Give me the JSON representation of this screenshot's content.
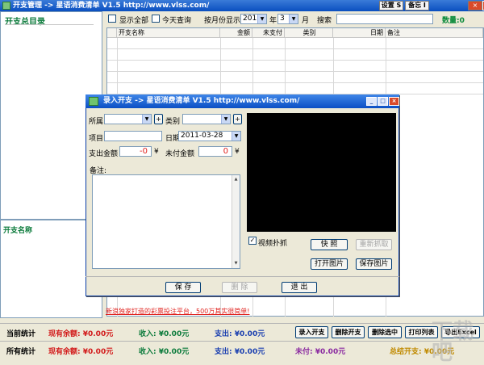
{
  "app": {
    "title": "开支管理 -> 星语消费清单 V1.5 http://www.vlss.com/",
    "settings_btn": "设置 S",
    "memo_btn": "备忘 I",
    "close_btn": "×"
  },
  "left": {
    "title": "开支总目录",
    "name_label": "开支名称"
  },
  "filter": {
    "show_all": "显示全部",
    "today_query": "今天查询",
    "by_month": "按月份显示",
    "year_value": "2011",
    "year_unit": "年",
    "month_value": "3",
    "month_unit": "月",
    "search_label": "搜索",
    "count_label": "数量:0"
  },
  "table": {
    "columns": [
      "",
      "开支名称",
      "金额",
      "未支付",
      "类别",
      "日期",
      "备注"
    ]
  },
  "dialog": {
    "title": "录入开支 -> 星语消费清单 V1.5 http://www.vlss.com/",
    "owner_label": "所属",
    "category_label": "类别",
    "item_label": "项目",
    "date_label": "日期",
    "date_value": "2011-03-28",
    "expense_label": "支出金额",
    "expense_value": "-0",
    "yen": "¥",
    "unpaid_label": "未付金额",
    "unpaid_value": "0",
    "memo_label": "备注:",
    "plus": "+",
    "video_capture": "视频扑抓",
    "snapshot_btn": "快 照",
    "recapture_btn": "重新抓取",
    "open_img_btn": "打开图片",
    "save_img_btn": "保存图片",
    "save_btn": "保 存",
    "delete_btn": "删 除",
    "exit_btn": "退 出"
  },
  "bottom": {
    "link_text": "新浪独家打造的彩票投注平台，500万其实很简单!",
    "current_label": "当前统计",
    "all_label": "所有统计",
    "current_balance": "现有余额: ¥0.00元",
    "current_income": "收入: ¥0.00元",
    "current_expense": "支出: ¥0.00元",
    "all_balance": "现有余额: ¥0.00元",
    "all_income": "收入: ¥0.00元",
    "all_expense": "支出: ¥0.00元",
    "all_unpaid": "未付: ¥0.00元",
    "total": "总结开支: ¥0.00元",
    "record_btn": "录入开支",
    "del_btn": "删除开支",
    "del_sel_btn": "删除选中",
    "print_btn": "打印列表",
    "export_btn": "导出Excel"
  },
  "watermark": "下载吧"
}
